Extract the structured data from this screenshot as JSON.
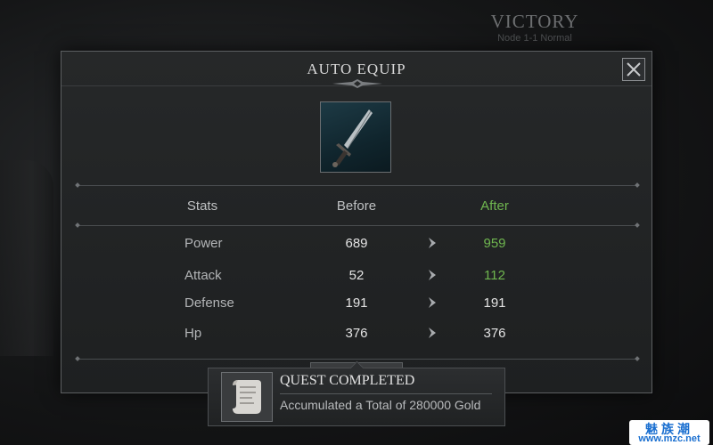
{
  "background": {
    "victory_title": "VICTORY",
    "node_label": "Node 1-1 Normal"
  },
  "modal": {
    "title": "AUTO EQUIP",
    "close_icon": "close-icon",
    "item_icon": "longsword-icon"
  },
  "stats": {
    "headers": {
      "stat": "Stats",
      "before": "Before",
      "after": "After"
    },
    "rows": [
      {
        "name": "Power",
        "before": "689",
        "after": "959",
        "improved": true
      },
      {
        "name": "Attack",
        "before": "52",
        "after": "112",
        "improved": true
      },
      {
        "name": "Defense",
        "before": "191",
        "after": "191",
        "improved": false
      },
      {
        "name": "Hp",
        "before": "376",
        "after": "376",
        "improved": false
      }
    ]
  },
  "quest": {
    "icon": "scroll-icon",
    "title": "QUEST COMPLETED",
    "description": "Accumulated a Total of 280000 Gold"
  },
  "watermark": {
    "line1": "魅族潮",
    "line2": "www.mzc.net"
  },
  "colors": {
    "improved": "#6fb64f",
    "unchanged": "#e3e3e3",
    "after_header": "#6fb64f"
  }
}
